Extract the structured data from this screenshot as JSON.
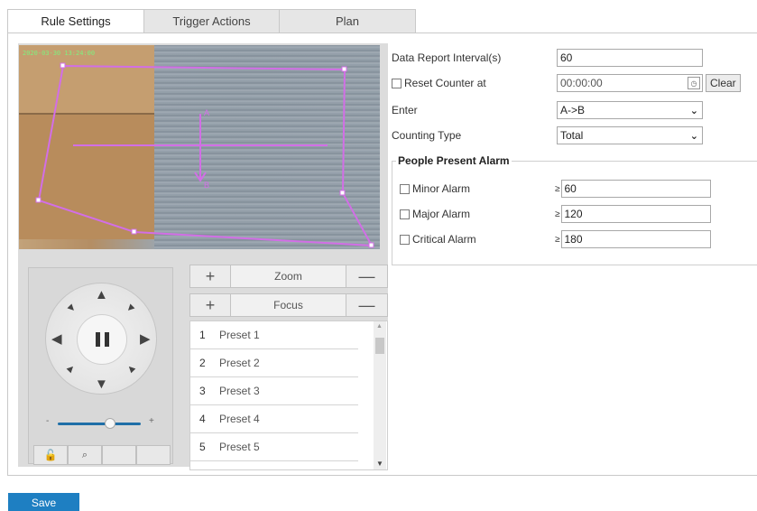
{
  "tabs": [
    {
      "label": "Rule Settings",
      "active": true
    },
    {
      "label": "Trigger Actions",
      "active": false
    },
    {
      "label": "Plan",
      "active": false
    }
  ],
  "video": {
    "osd_text": "2020-03-30 13:24:00"
  },
  "ptz": {
    "zoom_label": "Zoom",
    "focus_label": "Focus",
    "plus": "+",
    "minus": "—",
    "speed_min": "-",
    "speed_max": "+",
    "speed_level": 0.6
  },
  "presets": [
    {
      "num": "1",
      "name": "Preset 1"
    },
    {
      "num": "2",
      "name": "Preset 2"
    },
    {
      "num": "3",
      "name": "Preset 3"
    },
    {
      "num": "4",
      "name": "Preset 4"
    },
    {
      "num": "5",
      "name": "Preset 5"
    }
  ],
  "form": {
    "report_interval_label": "Data Report Interval(s)",
    "report_interval_value": "60",
    "reset_counter_label": "Reset Counter at",
    "reset_counter_value": "00:00:00",
    "reset_counter_checked": false,
    "clear_label": "Clear",
    "enter_label": "Enter",
    "enter_value": "A->B",
    "counting_type_label": "Counting Type",
    "counting_type_value": "Total"
  },
  "alarm": {
    "legend": "People Present Alarm",
    "ge_symbol": "≥",
    "items": [
      {
        "label": "Minor Alarm",
        "value": "60",
        "checked": false
      },
      {
        "label": "Major Alarm",
        "value": "120",
        "checked": false
      },
      {
        "label": "Critical Alarm",
        "value": "180",
        "checked": false
      }
    ]
  },
  "save_label": "Save",
  "colors": {
    "accent": "#1e7fc2",
    "rule_line": "#d26ee6"
  }
}
